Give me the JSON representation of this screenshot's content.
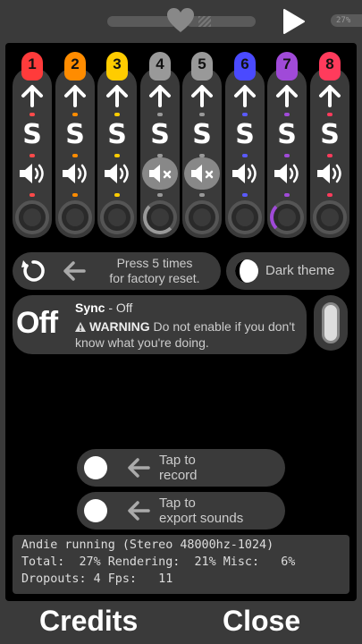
{
  "topbar": {
    "cpu_label": "27%",
    "heart_icon": "heart-icon",
    "play_icon": "play-icon"
  },
  "channels": [
    {
      "number": "1",
      "color": "#ff3b3b",
      "dot_color": "#ff4a4a",
      "muted": false,
      "knob_arc": "#ff4a4a"
    },
    {
      "number": "2",
      "color": "#ff8c00",
      "dot_color": "#ff8c00",
      "muted": false,
      "knob_arc": "#ff8c00"
    },
    {
      "number": "3",
      "color": "#ffcc00",
      "dot_color": "#ffcc00",
      "muted": false,
      "knob_arc": "#ffcc00"
    },
    {
      "number": "4",
      "color": "#999999",
      "dot_color": "#999999",
      "muted": true,
      "knob_arc": "#aaaaaa"
    },
    {
      "number": "5",
      "color": "#999999",
      "dot_color": "#999999",
      "muted": true,
      "knob_arc": "#aaaaaa"
    },
    {
      "number": "6",
      "color": "#4a4aff",
      "dot_color": "#5a5aff",
      "muted": false,
      "knob_arc": "#5a5aff"
    },
    {
      "number": "7",
      "color": "#a04ad8",
      "dot_color": "#a04ad8",
      "muted": false,
      "knob_arc": "#a04ad8"
    },
    {
      "number": "8",
      "color": "#ff3b5c",
      "dot_color": "#ff3b5c",
      "muted": false,
      "knob_arc": "#ff3b5c"
    }
  ],
  "channel_s_label": "S",
  "reset": {
    "text_line1": "Press 5 times",
    "text_line2": "for factory reset."
  },
  "theme": {
    "label": "Dark theme"
  },
  "sync": {
    "state_big": "Off",
    "title": "Sync",
    "title_suffix": " - Off",
    "warning_label": "WARNING",
    "warning_text": " Do not enable if you don't know what you're doing.",
    "enabled": false
  },
  "record": {
    "line1": "Tap to",
    "line2": "record"
  },
  "export": {
    "line1": "Tap to",
    "line2": "export sounds"
  },
  "stats": {
    "line1": "Andie running (Stereo 48000hz-1024)",
    "line2": "Total:  27% Rendering:  21% Misc:   6%",
    "line3": "Dropouts: 4 Fps:   11"
  },
  "bottom": {
    "credits_label": "Credits",
    "close_label": "Close"
  }
}
